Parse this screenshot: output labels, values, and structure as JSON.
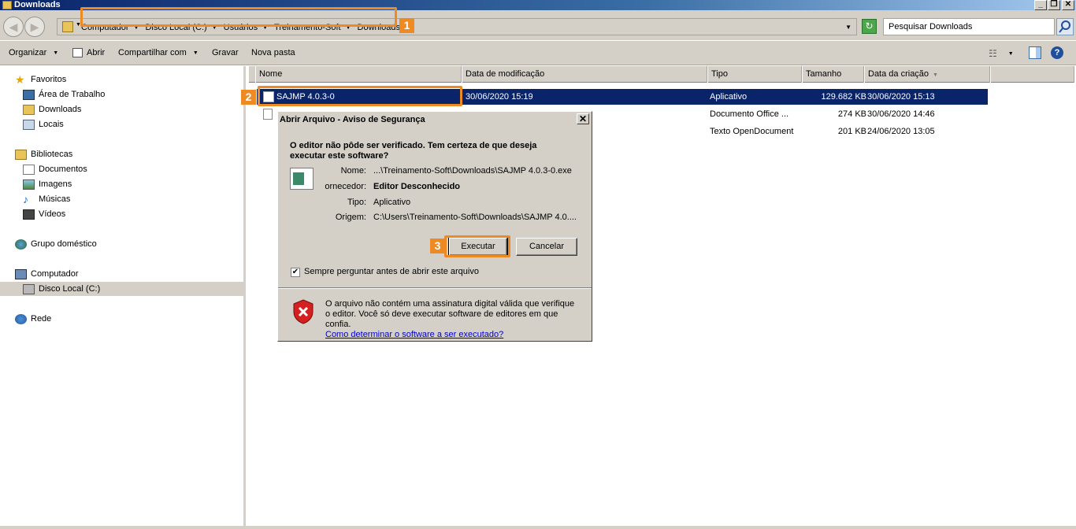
{
  "window": {
    "title": "Downloads"
  },
  "address": {
    "crumbs": [
      "Computador",
      "Disco Local (C:)",
      "Usuários",
      "Treinamento-Soft",
      "Downloads"
    ],
    "search_placeholder": "Pesquisar Downloads"
  },
  "toolbar": {
    "organize": "Organizar",
    "open": "Abrir",
    "share": "Compartilhar com",
    "burn": "Gravar",
    "new_folder": "Nova pasta"
  },
  "sidebar": {
    "favorites": "Favoritos",
    "favorite_items": [
      "Área de Trabalho",
      "Downloads",
      "Locais"
    ],
    "libraries": "Bibliotecas",
    "library_items": [
      "Documentos",
      "Imagens",
      "Músicas",
      "Vídeos"
    ],
    "homegroup": "Grupo doméstico",
    "computer": "Computador",
    "local_disk": "Disco Local (C:)",
    "network": "Rede"
  },
  "columns": {
    "name": "Nome",
    "modified": "Data de modificação",
    "type": "Tipo",
    "size": "Tamanho",
    "created": "Data da criação"
  },
  "files": [
    {
      "name": "SAJMP 4.0.3-0",
      "modified": "30/06/2020 15:19",
      "type": "Aplicativo",
      "size": "129.682 KB",
      "created": "30/06/2020 15:13"
    },
    {
      "name": "",
      "modified": "",
      "type": "Documento Office ...",
      "size": "274 KB",
      "created": "30/06/2020 14:46"
    },
    {
      "name": "",
      "modified": "",
      "type": "Texto OpenDocument",
      "size": "201 KB",
      "created": "24/06/2020 13:05"
    }
  ],
  "dialog": {
    "title": "Abrir Arquivo - Aviso de Segurança",
    "question": "O editor não pôde ser verificado. Tem certeza de que deseja executar este software?",
    "labels": {
      "name": "Nome:",
      "publisher": "ornecedor:",
      "type": "Tipo:",
      "origin": "Origem:"
    },
    "values": {
      "name": "...\\Treinamento-Soft\\Downloads\\SAJMP 4.0.3-0.exe",
      "publisher": "Editor Desconhecido",
      "type": "Aplicativo",
      "origin": "C:\\Users\\Treinamento-Soft\\Downloads\\SAJMP 4.0...."
    },
    "run": "Executar",
    "cancel": "Cancelar",
    "always_ask": "Sempre perguntar antes de abrir este arquivo",
    "warning": "O arquivo não contém uma assinatura digital válida que verifique o editor. Você só deve executar software de editores em que confia.",
    "warning_link": "Como determinar o software a ser executado?"
  },
  "badges": {
    "one": "1",
    "two": "2",
    "three": "3"
  },
  "colors": {
    "highlight": "#ee8a23",
    "selection": "#0a246a",
    "chrome": "#d4d0c8"
  }
}
